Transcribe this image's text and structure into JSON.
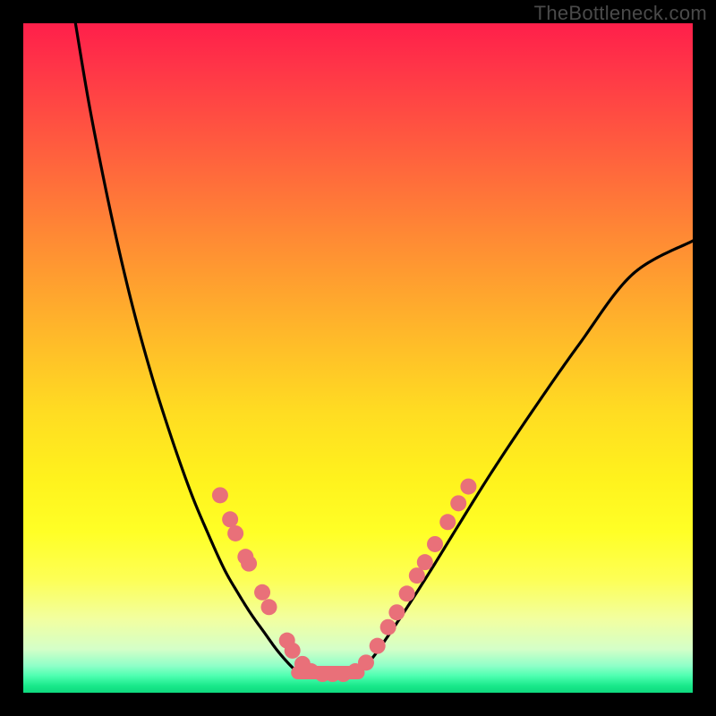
{
  "watermark": "TheBottleneck.com",
  "chart_data": {
    "type": "line",
    "title": "",
    "xlabel": "",
    "ylabel": "",
    "xlim": [
      0,
      1
    ],
    "ylim": [
      0,
      1
    ],
    "series": [
      {
        "name": "left-curve",
        "x": [
          0.078,
          0.1,
          0.13,
          0.16,
          0.19,
          0.22,
          0.25,
          0.275,
          0.3,
          0.32,
          0.34,
          0.36,
          0.378,
          0.395,
          0.41
        ],
        "y": [
          1.0,
          0.87,
          0.72,
          0.59,
          0.48,
          0.385,
          0.3,
          0.24,
          0.185,
          0.15,
          0.118,
          0.09,
          0.065,
          0.045,
          0.03
        ]
      },
      {
        "name": "right-curve",
        "x": [
          0.5,
          0.52,
          0.545,
          0.575,
          0.61,
          0.65,
          0.7,
          0.76,
          0.83,
          0.91,
          1.0
        ],
        "y": [
          0.03,
          0.05,
          0.085,
          0.13,
          0.185,
          0.25,
          0.33,
          0.42,
          0.52,
          0.625,
          0.675
        ]
      },
      {
        "name": "flat-bottom",
        "x": [
          0.41,
          0.5
        ],
        "y": [
          0.03,
          0.03
        ]
      }
    ],
    "markers": {
      "name": "dots",
      "points": [
        {
          "x": 0.294,
          "y": 0.295
        },
        {
          "x": 0.309,
          "y": 0.259
        },
        {
          "x": 0.317,
          "y": 0.238
        },
        {
          "x": 0.332,
          "y": 0.203
        },
        {
          "x": 0.337,
          "y": 0.193
        },
        {
          "x": 0.357,
          "y": 0.15
        },
        {
          "x": 0.367,
          "y": 0.128
        },
        {
          "x": 0.394,
          "y": 0.078
        },
        {
          "x": 0.402,
          "y": 0.063
        },
        {
          "x": 0.417,
          "y": 0.043
        },
        {
          "x": 0.43,
          "y": 0.032
        },
        {
          "x": 0.447,
          "y": 0.028
        },
        {
          "x": 0.462,
          "y": 0.028
        },
        {
          "x": 0.478,
          "y": 0.028
        },
        {
          "x": 0.496,
          "y": 0.032
        },
        {
          "x": 0.512,
          "y": 0.045
        },
        {
          "x": 0.529,
          "y": 0.07
        },
        {
          "x": 0.545,
          "y": 0.098
        },
        {
          "x": 0.558,
          "y": 0.12
        },
        {
          "x": 0.573,
          "y": 0.148
        },
        {
          "x": 0.588,
          "y": 0.175
        },
        {
          "x": 0.6,
          "y": 0.195
        },
        {
          "x": 0.615,
          "y": 0.222
        },
        {
          "x": 0.634,
          "y": 0.255
        },
        {
          "x": 0.65,
          "y": 0.283
        },
        {
          "x": 0.665,
          "y": 0.308
        }
      ]
    },
    "colors": {
      "curve": "#000000",
      "marker_fill": "#e97079",
      "marker_stroke": "#d85e68"
    }
  }
}
